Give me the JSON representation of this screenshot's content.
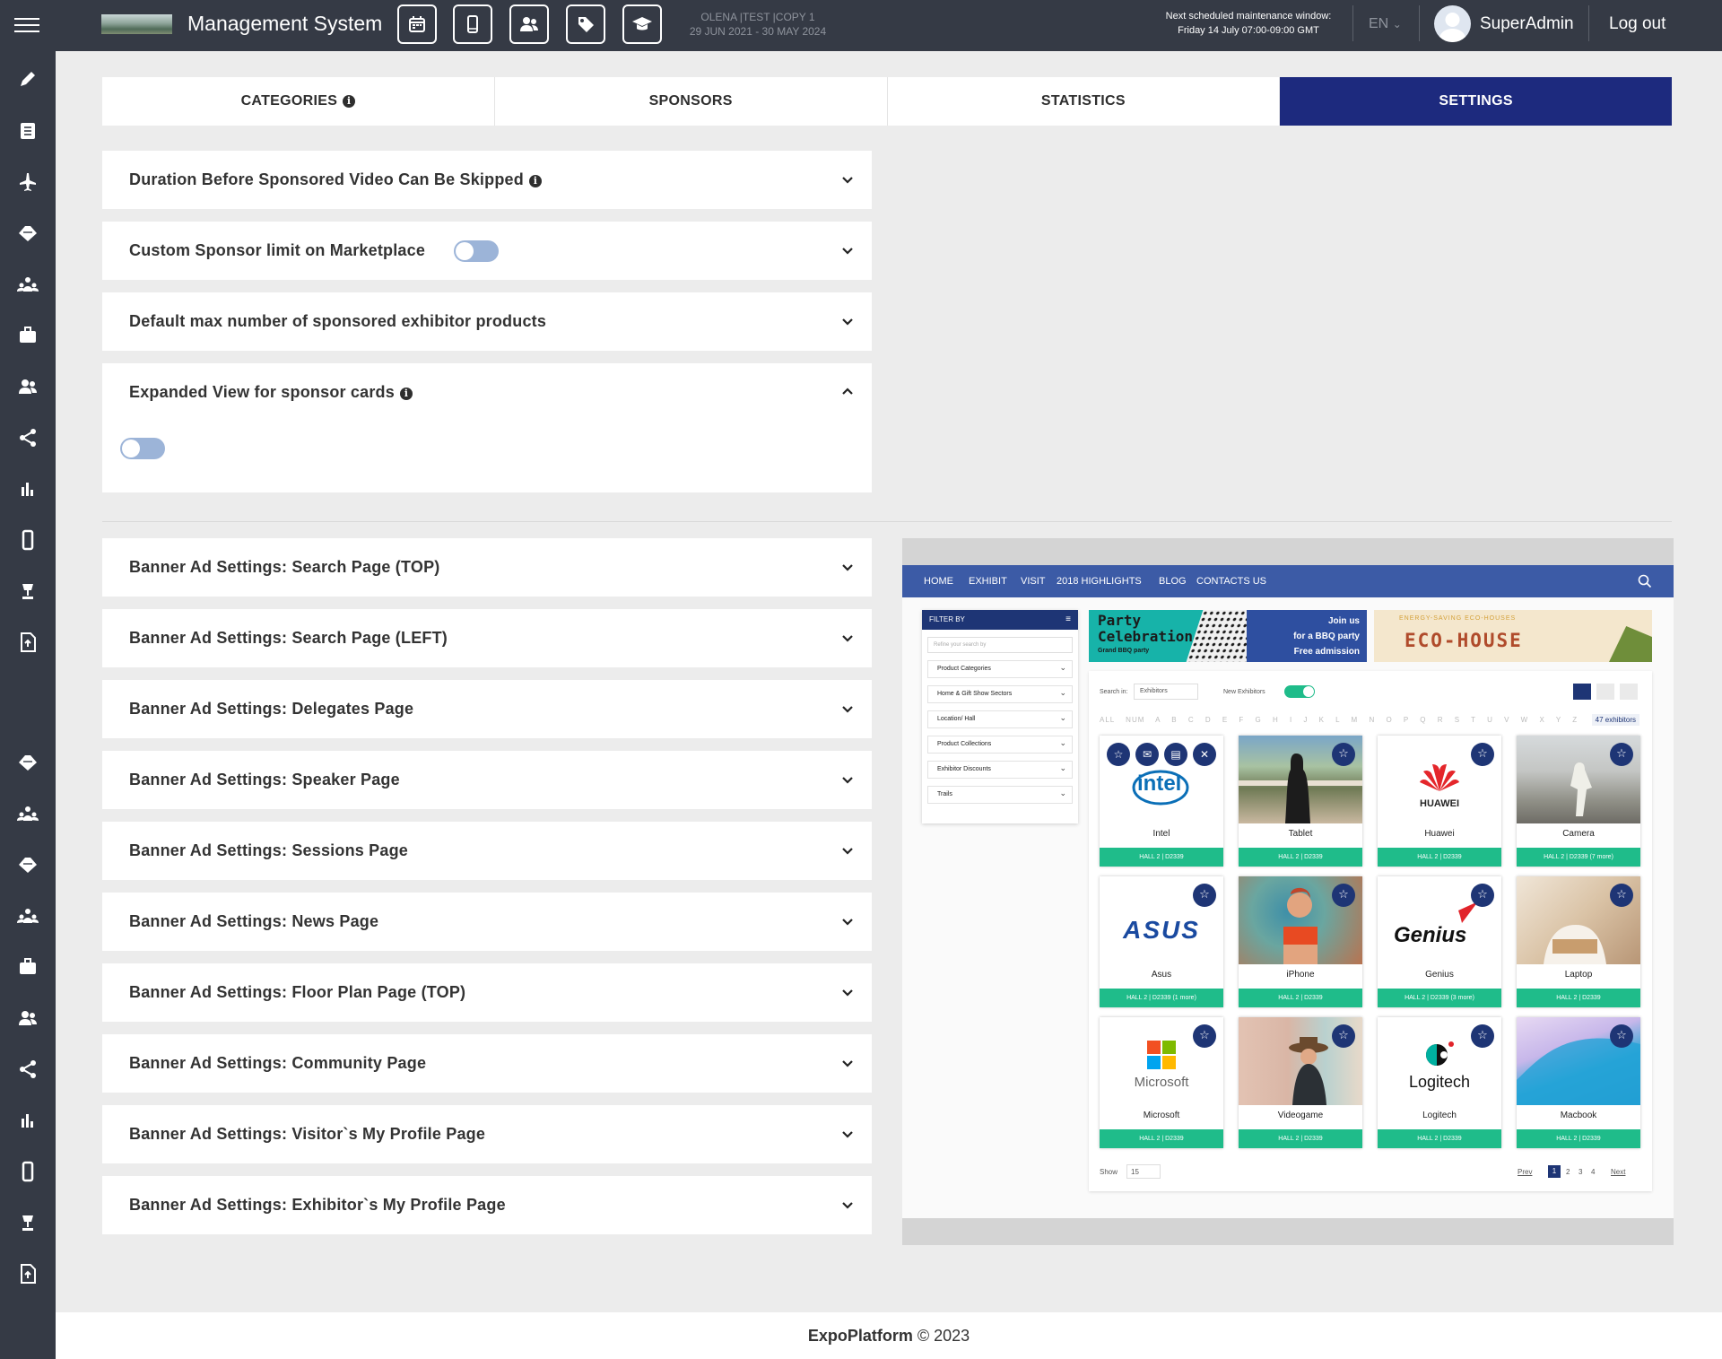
{
  "header": {
    "app_title": "Management System",
    "event_name": "OLENA |TEST |COPY 1",
    "event_dates": "29 JUN 2021 - 30 MAY 2024",
    "maintenance_label": "Next scheduled maintenance window:",
    "maintenance_time": "Friday 14 July 07:00-09:00 GMT",
    "language": "EN",
    "user_name": "SuperAdmin",
    "logout": "Log out",
    "toolbar_icons": [
      "calendar-icon",
      "mobile-icon",
      "people-icon",
      "tag-icon",
      "graduation-cap-icon"
    ]
  },
  "sidebar": {
    "icons": [
      "pencil-icon",
      "list-icon",
      "plane-icon",
      "tag-icon",
      "org-chart-icon",
      "briefcase-icon",
      "users-icon",
      "share-icon",
      "bar-chart-icon",
      "mobile-icon",
      "lamp-icon",
      "upload-file-icon",
      "tag-icon",
      "org-chart-icon",
      "tag-icon",
      "org-chart-icon",
      "briefcase-icon",
      "users-icon",
      "share-icon",
      "bar-chart-icon",
      "mobile-icon",
      "lamp-icon",
      "upload-file-icon"
    ]
  },
  "tabs": [
    {
      "label": "CATEGORIES",
      "info": true
    },
    {
      "label": "SPONSORS"
    },
    {
      "label": "STATISTICS"
    },
    {
      "label": "SETTINGS",
      "active": true
    }
  ],
  "settings_panels": [
    {
      "title": "Duration Before Sponsored Video Can Be Skipped",
      "info": true,
      "expanded": false
    },
    {
      "title": "Custom Sponsor limit on Marketplace",
      "toggle": false,
      "expanded": false
    },
    {
      "title": "Default max number of sponsored exhibitor products",
      "expanded": false
    },
    {
      "title": "Expanded View for sponsor cards",
      "info": true,
      "expanded": true,
      "toggle": false
    }
  ],
  "banner_panels": [
    "Banner Ad Settings: Search Page (TOP)",
    "Banner Ad Settings: Search Page (LEFT)",
    "Banner Ad Settings: Delegates Page",
    "Banner Ad Settings: Speaker Page",
    "Banner Ad Settings: Sessions Page",
    "Banner Ad Settings: News Page",
    "Banner Ad Settings: Floor Plan Page (TOP)",
    "Banner Ad Settings: Community Page",
    "Banner Ad Settings: Visitor`s My Profile Page",
    "Banner Ad Settings: Exhibitor`s My Profile Page"
  ],
  "preview": {
    "nav": [
      "HOME",
      "EXHIBIT",
      "VISIT",
      "2018 HIGHLIGHTS",
      "BLOG",
      "CONTACTS US"
    ],
    "filter_title": "FILTER BY",
    "filter_search_placeholder": "Refine your search by",
    "filters": [
      "Product Categories",
      "Home & Gift Show Sectors",
      "Location/ Hall",
      "Product Collections",
      "Exhibitor Discounts",
      "Trails"
    ],
    "banner_party": {
      "title": "Party Celebration",
      "sub": "Grand BBQ party",
      "line1": "Join us",
      "line2": "for a BBQ party",
      "line3": "Free admission"
    },
    "banner_eco": {
      "top": "ENERGY-SAVING ECO-HOUSES",
      "title": "ECO-HOUSE"
    },
    "search_in_label": "Search in:",
    "search_in_value": "Exhibitors",
    "new_exhibitors_label": "New Exhibitors",
    "alphabet": "ALL NUM A B C D E F G H I J K L M N O P Q R S T U V W X Y Z",
    "count": "47 exhibitors",
    "cards": [
      {
        "name": "Intel",
        "hall": "HALL 2 | D2339"
      },
      {
        "name": "Tablet",
        "hall": "HALL 2 | D2339"
      },
      {
        "name": "Huawei",
        "hall": "HALL 2 | D2339"
      },
      {
        "name": "Camera",
        "hall": "HALL 2 | D2339 (7 more)"
      },
      {
        "name": "Asus",
        "hall": "HALL 2 | D2339 (1 more)"
      },
      {
        "name": "iPhone",
        "hall": "HALL 2 | D2339"
      },
      {
        "name": "Genius",
        "hall": "HALL 2 | D2339 (3 more)"
      },
      {
        "name": "Laptop",
        "hall": "HALL 2 | D2339"
      },
      {
        "name": "Microsoft",
        "hall": "HALL 2 | D2339"
      },
      {
        "name": "Videogame",
        "hall": "HALL 2 | D2339"
      },
      {
        "name": "Logitech",
        "hall": "HALL 2 | D2339"
      },
      {
        "name": "Macbook",
        "hall": "HALL 2 | D2339"
      }
    ],
    "logos": {
      "intel": "intel",
      "huawei": "HUAWEI",
      "asus": "ASUS",
      "genius": "Genius",
      "microsoft": "Microsoft",
      "logitech": "Logitech"
    },
    "show_label": "Show",
    "show_value": "15",
    "prev": "Prev",
    "pages": [
      "1",
      "2",
      "3",
      "4"
    ],
    "next": "Next"
  },
  "footer": {
    "brand": "ExpoPlatform",
    "copy": "© 2023"
  },
  "colors": {
    "topbar": "#353a45",
    "active_tab": "#1d2a7e",
    "toggle_off": "#9cb4d8",
    "preview_nav": "#3c5ba6",
    "hall_green": "#1fbc8a",
    "star_navy": "#1e3575"
  }
}
